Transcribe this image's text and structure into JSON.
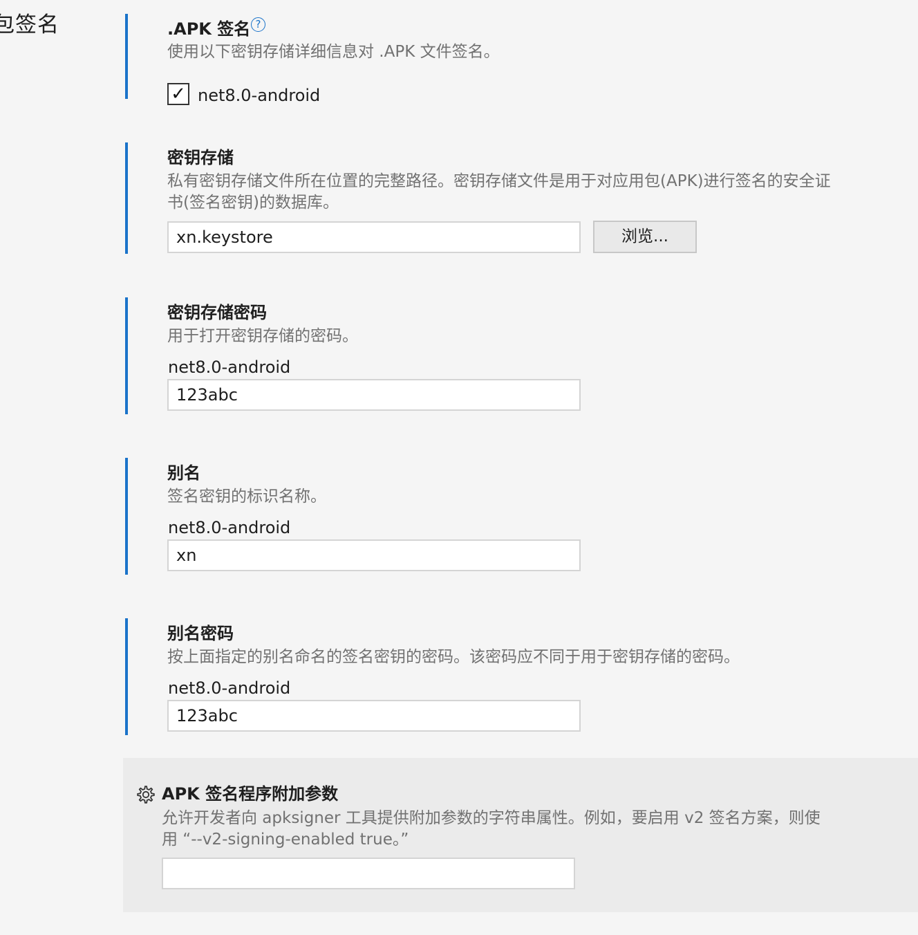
{
  "page": {
    "heading": "包签名"
  },
  "apk_signing": {
    "title": ".APK 签名",
    "description": "使用以下密钥存储详细信息对 .APK 文件签名。",
    "checkbox_label": "net8.0-android",
    "checked": true,
    "check_glyph": "✓"
  },
  "keystore": {
    "title": "密钥存储",
    "description_lines": [
      "私有密钥存储文件所在位置的完整路径。密钥存储文件是用于对应用包(APK)进行签名的安全证",
      "书(签名密钥)的数据库。"
    ],
    "value": "xn.keystore",
    "browse_label": "浏览..."
  },
  "keystore_password": {
    "title": "密钥存储密码",
    "description": "用于打开密钥存储的密码。",
    "field_label": "net8.0-android",
    "value": "123abc"
  },
  "alias": {
    "title": "别名",
    "description": "签名密钥的标识名称。",
    "field_label": "net8.0-android",
    "value": "xn"
  },
  "alias_password": {
    "title": "别名密码",
    "description": "按上面指定的别名命名的签名密钥的密码。该密码应不同于用于密钥存储的密码。",
    "field_label": "net8.0-android",
    "value": "123abc"
  },
  "additional_args": {
    "icon": "gear-icon",
    "title": "APK 签名程序附加参数",
    "description_lines": [
      "允许开发者向 apksigner 工具提供附加参数的字符串属性。例如，要启用 v2 签名方案，则使",
      "用 “--v2-signing-enabled true。”"
    ],
    "value": ""
  },
  "colors": {
    "accent": "#1a73c9",
    "background": "#f5f5f5",
    "muted_text": "#717171"
  }
}
